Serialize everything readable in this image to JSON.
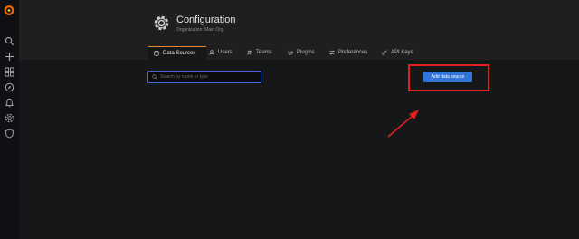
{
  "header": {
    "title": "Configuration",
    "subtitle": "Organization: Main Org."
  },
  "tabs": [
    {
      "label": "Data Sources",
      "icon": "database-icon",
      "active": true
    },
    {
      "label": "Users",
      "icon": "user-icon"
    },
    {
      "label": "Teams",
      "icon": "users-icon"
    },
    {
      "label": "Plugins",
      "icon": "plug-icon"
    },
    {
      "label": "Preferences",
      "icon": "sliders-icon"
    },
    {
      "label": "API Keys",
      "icon": "key-icon"
    }
  ],
  "search": {
    "placeholder": "Search by name or type"
  },
  "actions": {
    "add_label": "Add data source"
  },
  "sidebar": {
    "icons": [
      "grafana-logo-icon",
      "search-icon",
      "plus-icon",
      "dashboards-icon",
      "explore-icon",
      "alerting-icon",
      "configuration-icon",
      "shield-icon"
    ]
  },
  "colors": {
    "accent_blue": "#3274d9",
    "active_tab_border": "#e9892f",
    "annotation_red": "#e02020",
    "background": "#161719",
    "header_background": "#1f1f20"
  }
}
